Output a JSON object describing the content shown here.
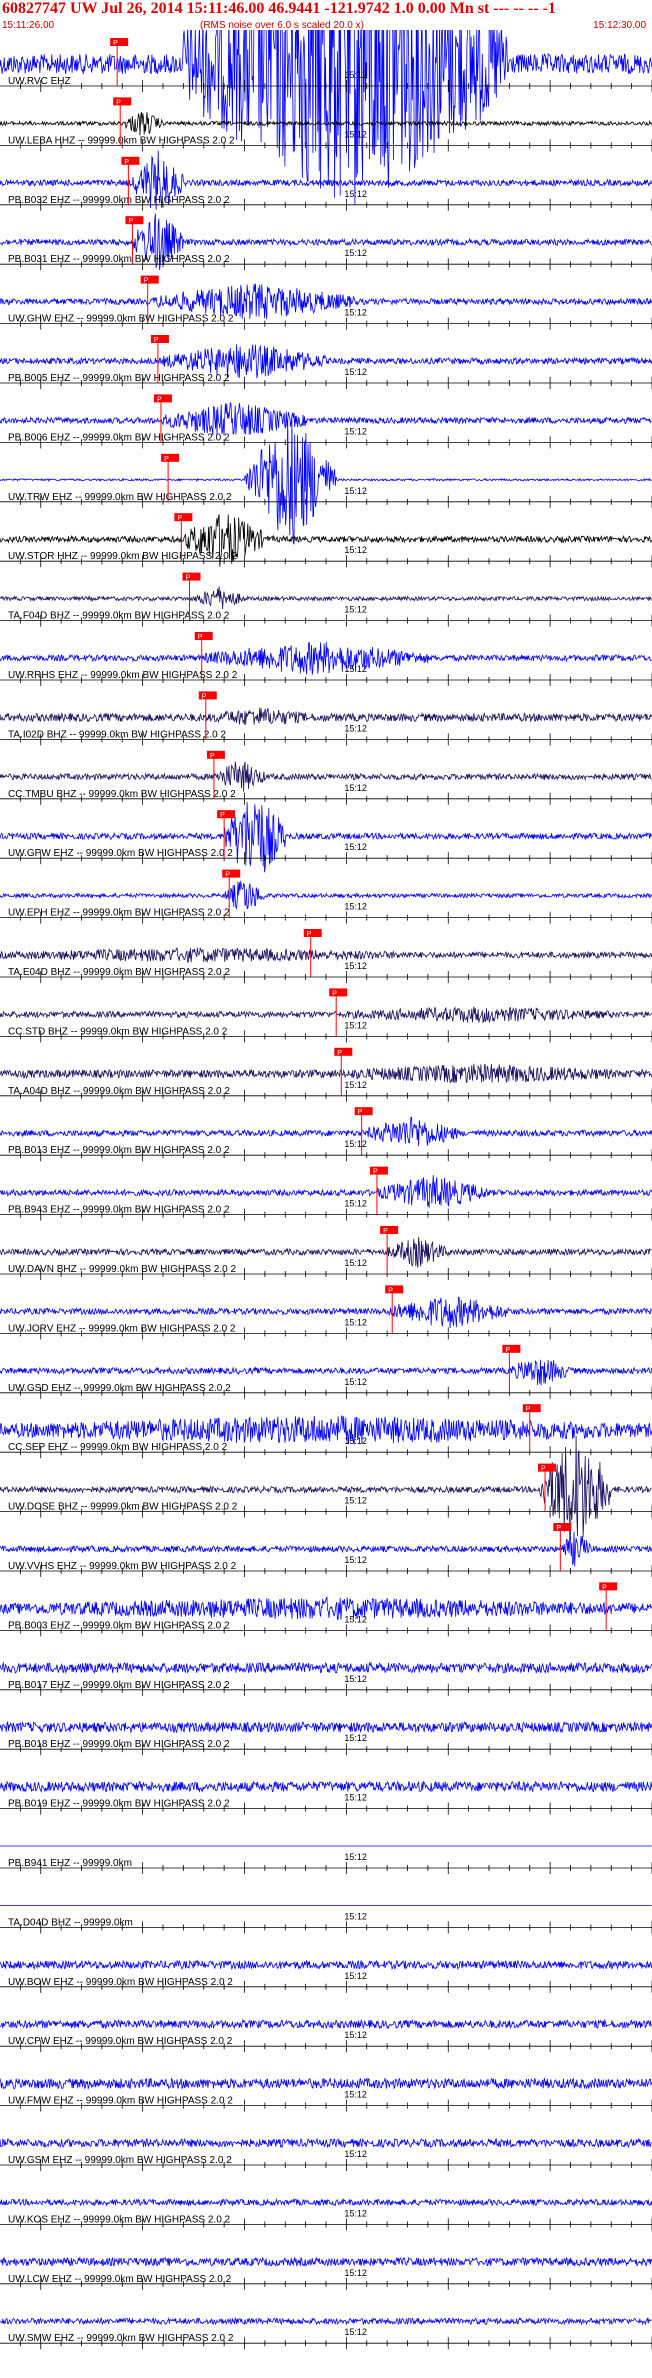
{
  "header": {
    "title": "60827747 UW Jul 26, 2014 15:11:46.00   46.9441 -121.9742  1.0 0.00 Mn st --- -- --  -1",
    "subtitle": "(RMS noise over 6.0 s scaled 20.0 x)",
    "start_time": "15:11:26.00",
    "end_time": "15:12:30.00"
  },
  "chart_data": {
    "type": "line",
    "title": "60827747 UW Jul 26, 2014 15:11:46.00   46.9441 -121.9742  1.0 0.00 Mn st --- -- --  -1",
    "subtitle": "(RMS noise over 6.0 s scaled 20.0 x)",
    "xrange_seconds": [
      0,
      64
    ],
    "x_start": "15:11:26.00",
    "x_end": "15:12:30.00",
    "minute_mark_label": "15:12",
    "minute_mark_seconds": 34,
    "pick_label": "P",
    "colors": {
      "blue": "#0000ff",
      "black": "#000000",
      "dark": "#1a1060",
      "pick": "#ff0000",
      "grid": "#000000"
    },
    "series": [
      {
        "label": "UW.RVC EHZ",
        "color": "blue",
        "pick_s": 11.5,
        "amp": 10,
        "event": [
          [
            18,
            50,
            0.9,
            5
          ]
        ]
      },
      {
        "label": "UW.LEBA HHZ -- 99999.0km BW  HIGHPASS  2.0  2",
        "color": "black",
        "pick_s": 11.8,
        "amp": 2,
        "event": [
          [
            12,
            16,
            0.2,
            3
          ]
        ]
      },
      {
        "label": "PB.B032 EHZ -- 99999.0km BW  HIGHPASS  2.0  2",
        "color": "blue",
        "pick_s": 12.6,
        "amp": 3,
        "event": [
          [
            13,
            18,
            0.8,
            3
          ]
        ]
      },
      {
        "label": "PB.B031 EHZ -- 99999.0km BW  HIGHPASS  2.0  2",
        "color": "blue",
        "pick_s": 13.0,
        "amp": 3,
        "event": [
          [
            13,
            18,
            0.8,
            3
          ]
        ]
      },
      {
        "label": "UW.GHW EHZ -- 99999.0km BW  HIGHPASS  2.0  2",
        "color": "blue",
        "pick_s": 14.5,
        "amp": 3,
        "event": [
          [
            15,
            35,
            0.6,
            2
          ]
        ]
      },
      {
        "label": "PB.B005 EHZ -- 99999.0km BW  HIGHPASS  2.0  2",
        "color": "blue",
        "pick_s": 15.5,
        "amp": 3,
        "event": [
          [
            16,
            32,
            0.6,
            2
          ]
        ]
      },
      {
        "label": "PB.B006 EHZ -- 99999.0km BW  HIGHPASS  2.0  2",
        "color": "blue",
        "pick_s": 15.8,
        "amp": 3,
        "event": [
          [
            16,
            30,
            0.6,
            2
          ]
        ]
      },
      {
        "label": "UW.TRW EHZ -- 99999.0km BW  HIGHPASS  2.0  2",
        "color": "blue",
        "pick_s": 16.5,
        "amp": 1,
        "event": [
          [
            24,
            33,
            1.0,
            12
          ]
        ]
      },
      {
        "label": "UW.STOR HHZ -- 99999.0km BW  HIGHPASS  2.0  2",
        "color": "black",
        "pick_s": 17.8,
        "amp": 3,
        "event": [
          [
            18,
            26,
            0.7,
            3
          ]
        ]
      },
      {
        "label": "TA.F04D BHZ -- 99999.0km BW  HIGHPASS  2.0  2",
        "color": "dark",
        "pick_s": 18.6,
        "amp": 2,
        "event": [
          [
            19,
            24,
            0.4,
            2
          ]
        ]
      },
      {
        "label": "UW.RRHS EHZ -- 99999.0km BW  HIGHPASS  2.0  2",
        "color": "blue",
        "pick_s": 19.8,
        "amp": 3,
        "event": [
          [
            20,
            42,
            0.5,
            2
          ]
        ]
      },
      {
        "label": "TA.I02D BHZ -- 99999.0km BW  HIGHPASS  2.0  2",
        "color": "dark",
        "pick_s": 20.2,
        "amp": 4,
        "event": [
          [
            21,
            30,
            0.3,
            1
          ]
        ]
      },
      {
        "label": "CC.TMBU BHZ -- 99999.0km BW  HIGHPASS  2.0  2",
        "color": "dark",
        "pick_s": 21.0,
        "amp": 3,
        "event": [
          [
            21,
            26,
            0.5,
            2
          ]
        ]
      },
      {
        "label": "UW.GPW EHZ -- 99999.0km BW  HIGHPASS  2.0  2",
        "color": "blue",
        "pick_s": 22.0,
        "amp": 3,
        "event": [
          [
            22,
            28,
            1.0,
            4
          ]
        ]
      },
      {
        "label": "UW.EPH EHZ -- 99999.0km BW  HIGHPASS  2.0  2",
        "color": "blue",
        "pick_s": 22.5,
        "amp": 2,
        "event": [
          [
            22,
            26,
            0.5,
            3
          ]
        ]
      },
      {
        "label": "TA.E04D BHZ -- 99999.0km BW  HIGHPASS  2.0  2",
        "color": "dark",
        "pick_s": 30.5,
        "amp": 3,
        "event": [
          [
            0,
            40,
            0.2,
            1
          ]
        ]
      },
      {
        "label": "CC.STD BHZ -- 99999.0km BW  HIGHPASS  2.0  2",
        "color": "dark",
        "pick_s": 33.0,
        "amp": 3,
        "event": [
          [
            34,
            60,
            0.3,
            1
          ]
        ]
      },
      {
        "label": "TA.A04D BHZ -- 99999.0km BW  HIGHPASS  2.0  2",
        "color": "dark",
        "pick_s": 33.5,
        "amp": 4,
        "event": [
          [
            34,
            60,
            0.3,
            1
          ]
        ]
      },
      {
        "label": "PB.B013 EHZ -- 99999.0km BW  HIGHPASS  2.0  2",
        "color": "blue",
        "pick_s": 35.5,
        "amp": 3,
        "event": [
          [
            36,
            45,
            0.5,
            2
          ]
        ]
      },
      {
        "label": "PB.B943 EHZ -- 99999.0km BW  HIGHPASS  2.0  2",
        "color": "blue",
        "pick_s": 37.0,
        "amp": 3,
        "event": [
          [
            37,
            48,
            0.5,
            2
          ]
        ]
      },
      {
        "label": "UW.DAVN BHZ -- 99999.0km BW  HIGHPASS  2.0  2",
        "color": "dark",
        "pick_s": 38.0,
        "amp": 3,
        "event": [
          [
            38,
            44,
            0.4,
            2
          ]
        ]
      },
      {
        "label": "UW.JORV EHZ -- 99999.0km BW  HIGHPASS  2.0  2",
        "color": "blue",
        "pick_s": 38.5,
        "amp": 3,
        "event": [
          [
            38,
            50,
            0.5,
            2
          ]
        ]
      },
      {
        "label": "UW.GSD EHZ -- 99999.0km BW  HIGHPASS  2.0  2",
        "color": "blue",
        "pick_s": 50.0,
        "amp": 3,
        "event": [
          [
            50,
            56,
            0.4,
            2
          ]
        ]
      },
      {
        "label": "CC.SEP EHZ -- 99999.0km BW  HIGHPASS  2.0  2",
        "color": "blue",
        "pick_s": 52.0,
        "amp": 5,
        "event": [
          [
            0,
            64,
            0.5,
            1
          ]
        ]
      },
      {
        "label": "UW.DOSE BHZ -- 99999.0km BW  HIGHPASS  2.0  2",
        "color": "dark",
        "pick_s": 53.5,
        "amp": 3,
        "event": [
          [
            53,
            60,
            1.0,
            5
          ]
        ]
      },
      {
        "label": "UW.VVHS EHZ -- 99999.0km BW  HIGHPASS  2.0  2",
        "color": "blue",
        "pick_s": 55.0,
        "amp": 3,
        "event": [
          [
            55,
            58,
            0.6,
            2
          ]
        ]
      },
      {
        "label": "PB.B003 EHZ -- 99999.0km BW  HIGHPASS  2.0  2",
        "color": "blue",
        "pick_s": 59.5,
        "amp": 4,
        "event": [
          [
            0,
            64,
            0.4,
            1
          ]
        ]
      },
      {
        "label": "PB.B017 EHZ -- 99999.0km BW  HIGHPASS  2.0  2",
        "color": "blue",
        "pick_s": null,
        "amp": 5,
        "event": []
      },
      {
        "label": "PB.B018 EHZ -- 99999.0km BW  HIGHPASS  2.0  2",
        "color": "blue",
        "pick_s": null,
        "amp": 5,
        "event": []
      },
      {
        "label": "PB.B019 EHZ -- 99999.0km BW  HIGHPASS  2.0  2",
        "color": "blue",
        "pick_s": null,
        "amp": 5,
        "event": []
      },
      {
        "label": "PB.B941 EHZ -- 99999.0km",
        "color": "blue",
        "pick_s": null,
        "amp": 0,
        "event": []
      },
      {
        "label": "TA.D04D BHZ -- 99999.0km",
        "color": "blue",
        "pick_s": null,
        "amp": 0,
        "event": []
      },
      {
        "label": "UW.BOW EHZ -- 99999.0km BW  HIGHPASS  2.0  2",
        "color": "blue",
        "pick_s": null,
        "amp": 4,
        "event": []
      },
      {
        "label": "UW.CPW EHZ -- 99999.0km BW  HIGHPASS  2.0  2",
        "color": "blue",
        "pick_s": null,
        "amp": 4,
        "event": []
      },
      {
        "label": "UW.FMW EHZ -- 99999.0km BW  HIGHPASS  2.0  2",
        "color": "blue",
        "pick_s": null,
        "amp": 5,
        "event": []
      },
      {
        "label": "UW.GSM EHZ -- 99999.0km BW  HIGHPASS  2.0  2",
        "color": "blue",
        "pick_s": null,
        "amp": 4,
        "event": []
      },
      {
        "label": "UW.KOS EHZ -- 99999.0km BW  HIGHPASS  2.0  2",
        "color": "blue",
        "pick_s": null,
        "amp": 3,
        "event": []
      },
      {
        "label": "UW.LCW EHZ -- 99999.0km BW  HIGHPASS  2.0  2",
        "color": "blue",
        "pick_s": null,
        "amp": 4,
        "event": []
      },
      {
        "label": "UW.SMW EHZ -- 99999.0km BW  HIGHPASS  2.0  2",
        "color": "blue",
        "pick_s": null,
        "amp": 3,
        "event": []
      }
    ]
  }
}
